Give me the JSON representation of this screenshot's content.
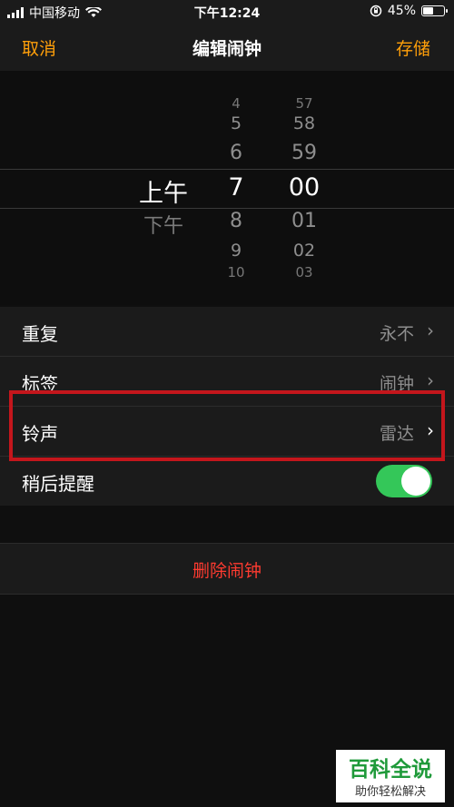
{
  "status_bar": {
    "carrier": "中国移动",
    "time": "下午12:24",
    "battery": "45%",
    "battery_level": 0.45,
    "icons": [
      "signal-icon",
      "wifi-icon",
      "orientation-lock-icon",
      "battery-icon"
    ]
  },
  "nav": {
    "cancel": "取消",
    "title": "编辑闹钟",
    "save": "存储"
  },
  "picker": {
    "ampm": [
      "上午",
      "下午"
    ],
    "hours": [
      "4",
      "5",
      "6",
      "7",
      "8",
      "9",
      "10"
    ],
    "minutes": [
      "57",
      "58",
      "59",
      "00",
      "01",
      "02",
      "03"
    ],
    "selected": {
      "ampm": "上午",
      "hour": "7",
      "minute": "00"
    }
  },
  "settings": [
    {
      "label": "重复",
      "value": "永不"
    },
    {
      "label": "标签",
      "value": "闹钟"
    },
    {
      "label": "铃声",
      "value": "雷达"
    },
    {
      "label": "稍后提醒",
      "toggle": true
    }
  ],
  "delete_label": "删除闹钟",
  "watermark": {
    "title": "百科全说",
    "subtitle": "助你轻松解决"
  },
  "colors": {
    "accent": "#ff9f0a",
    "danger": "#ff3b30",
    "toggle_on": "#34c759",
    "highlight": "#c4161c"
  }
}
